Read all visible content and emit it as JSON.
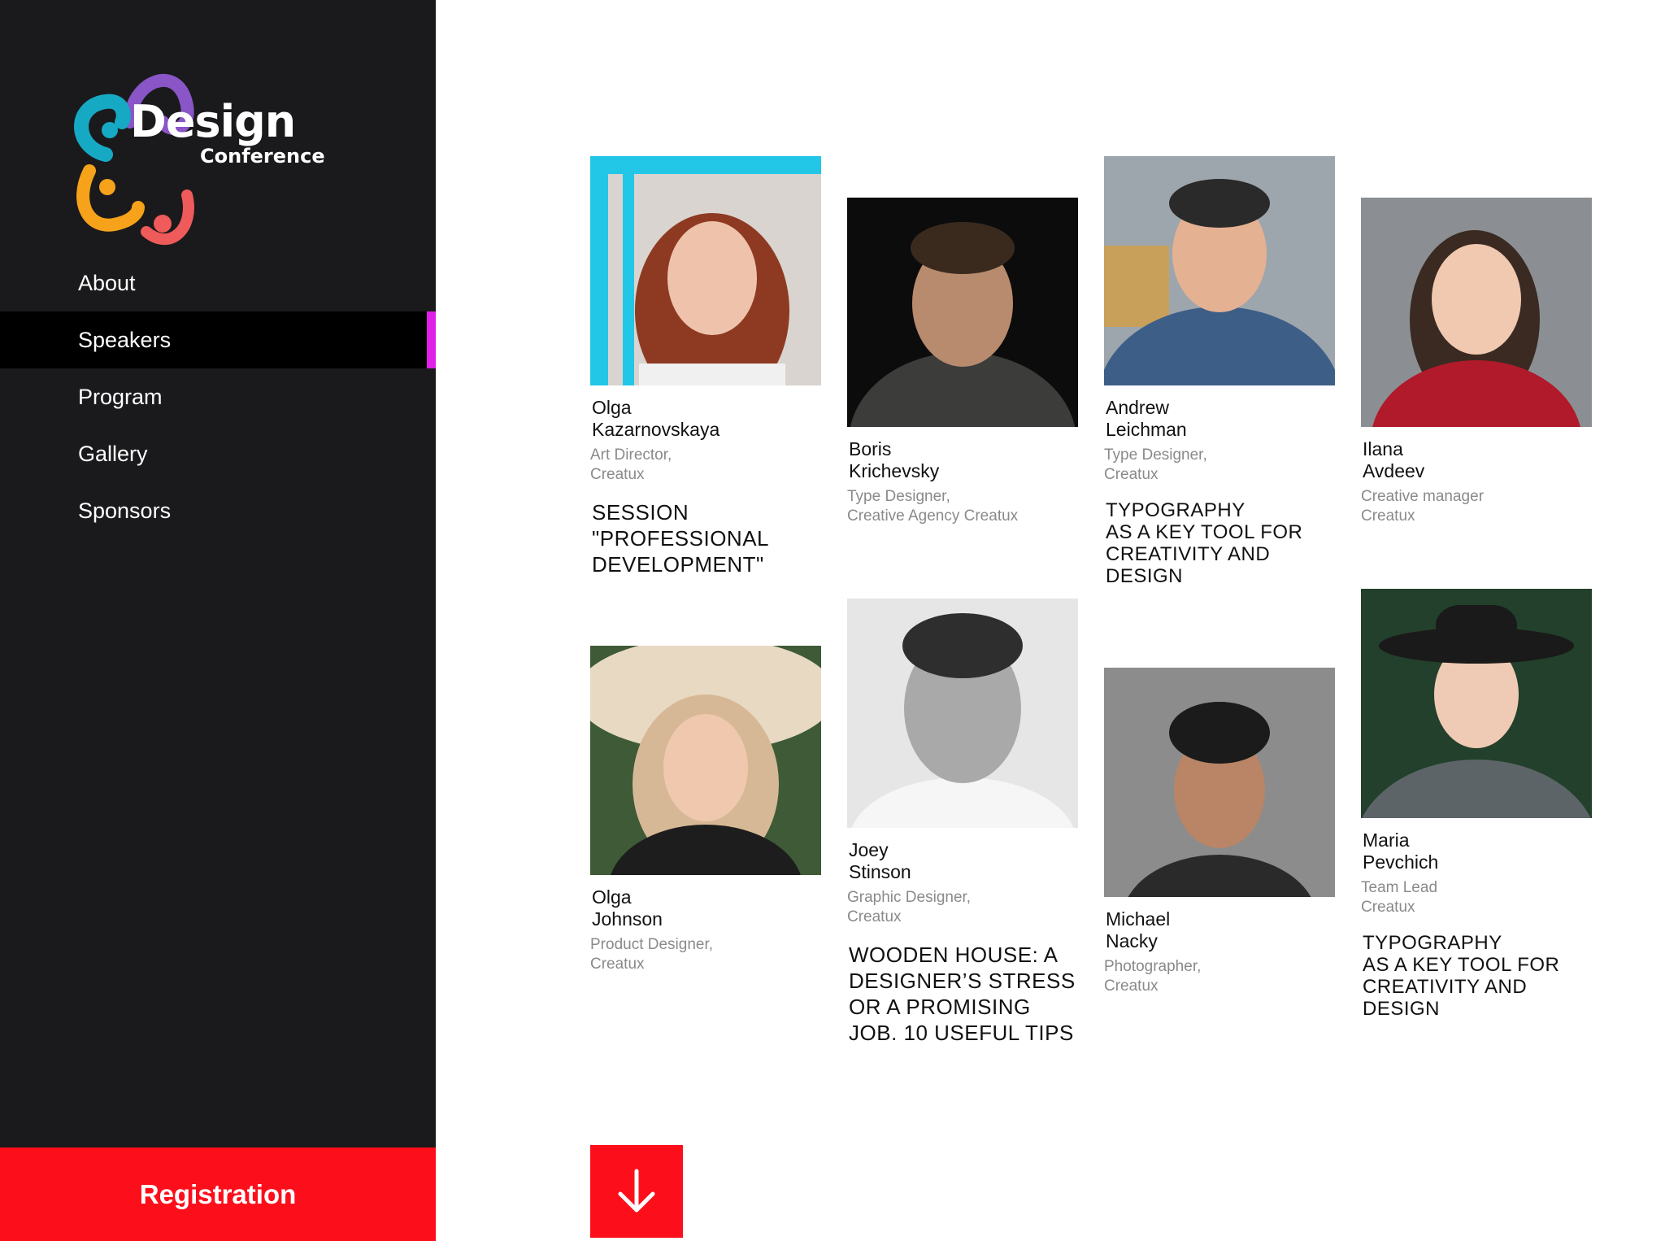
{
  "logo": {
    "word": "Design",
    "subtitle": "Conference"
  },
  "nav": [
    {
      "label": "About",
      "active": false
    },
    {
      "label": "Speakers",
      "active": true
    },
    {
      "label": "Program",
      "active": false
    },
    {
      "label": "Gallery",
      "active": false
    },
    {
      "label": "Sponsors",
      "active": false
    }
  ],
  "registration_label": "Registration",
  "colors": {
    "sidebar_bg": "#1a1a1c",
    "active_bg": "#000000",
    "active_marker": "#e020e6",
    "accent_red": "#fc0f1b"
  },
  "speakers": [
    {
      "name": "Olga\nKazarnovskaya",
      "role": "Art Director,\nCreatux",
      "talk": "Session\n\"Professional\nDevelopment\""
    },
    {
      "name": "Boris\nKrichevsky",
      "role": "Type Designer,\nCreative Agency Creatux",
      "talk": ""
    },
    {
      "name": "Andrew\nLeichman",
      "role": "Type Designer,\nCreatux",
      "talk": "Typography\nas a key tool for\ncreativity and\ndesign"
    },
    {
      "name": "Ilana\nAvdeev",
      "role": "Creative manager\nCreatux",
      "talk": ""
    },
    {
      "name": "Olga\nJohnson",
      "role": "Product Designer,\nCreatux",
      "talk": ""
    },
    {
      "name": "Joey\nStinson",
      "role": "Graphic Designer,\nCreatux",
      "talk": "Wooden house: a\ndesigner’s stress\nor a promising\njob. 10 useful tips"
    },
    {
      "name": "Michael\nNacky",
      "role": "Photographer,\nCreatux",
      "talk": ""
    },
    {
      "name": "Maria\nPevchich",
      "role": "Team Lead\nCreatux",
      "talk": "Typography\nas a key tool for\ncreativity and\ndesign"
    }
  ],
  "scroll_icon": "arrow-down-icon"
}
